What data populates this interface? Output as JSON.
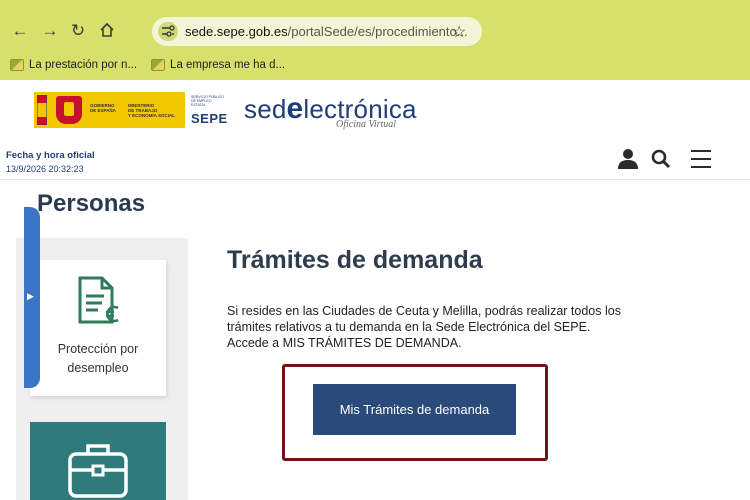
{
  "browser": {
    "url_domain": "sede.sepe.gob.es",
    "url_path": "/portalSede/es/procedimiento...",
    "bookmarks": [
      {
        "label": "La prestación por n..."
      },
      {
        "label": "La empresa me ha d..."
      }
    ]
  },
  "header": {
    "gobierno_lines": [
      "GOBIERNO",
      "DE ESPAÑA"
    ],
    "ministerio_lines": [
      "MINISTERIO",
      "DE TRABAJO",
      "Y ECONOMÍA SOCIAL"
    ],
    "sepe_small": "SERVICIO PÚBLICO DE EMPLEO ESTATAL",
    "sepe": "SEPE",
    "sede_prefix": "sed",
    "sede_e": "e",
    "sede_suffix": "lectrónica",
    "sede_sub": "Oficina Virtual",
    "fecha_label": "Fecha y hora oficial",
    "fecha_value": "13/9/2026  20:32:23"
  },
  "page": {
    "title": "Personas",
    "card1_label": "Protección por desempleo",
    "section_title": "Trámites de demanda",
    "description": "Si resides en las Ciudades de Ceuta y Melilla, podrás realizar todos los trámites relativos a tu demanda en la Sede Electrónica del SEPE.",
    "description2": "Accede a MIS TRÁMITES DE DEMANDA.",
    "cta_label": "Mis Trámites de demanda"
  },
  "colors": {
    "chrome": "#d6e06a",
    "brand_blue": "#1f3e78",
    "button": "#2a4a7a",
    "highlight": "#6e1515",
    "teal_card": "#2f7a7b"
  }
}
